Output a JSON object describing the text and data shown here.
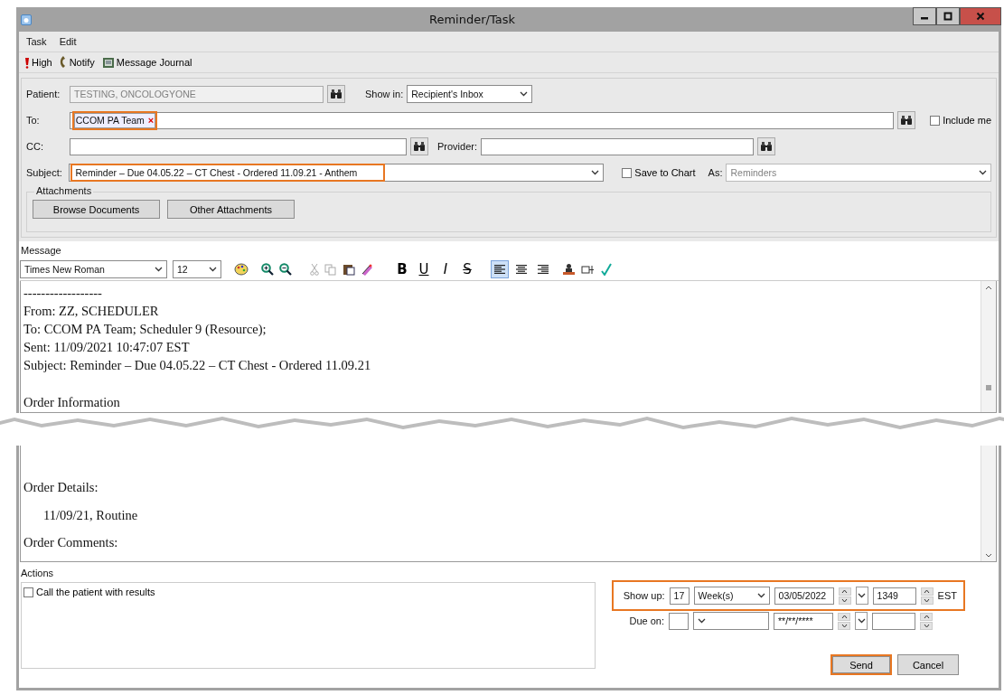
{
  "window": {
    "title": "Reminder/Task"
  },
  "menu": [
    {
      "label": "Task"
    },
    {
      "label": "Edit"
    }
  ],
  "toolbar": [
    {
      "kind": "priority",
      "label": "High"
    },
    {
      "kind": "phone",
      "label": "Notify"
    },
    {
      "kind": "journal",
      "label": "Message Journal"
    }
  ],
  "form": {
    "patient": {
      "label": "Patient:",
      "value": "TESTING, ONCOLOGYONE",
      "disabled": true
    },
    "show_in": {
      "label": "Show in:",
      "value": "Recipient's Inbox"
    },
    "to": {
      "label": "To:",
      "recipients": [
        {
          "name": "CCOM PA Team",
          "remove": "×"
        }
      ],
      "highlighted": true
    },
    "include_me": {
      "label": "Include me",
      "checked": false
    },
    "cc": {
      "label": "CC:"
    },
    "provider": {
      "label": "Provider:"
    },
    "subject": {
      "label": "Subject:",
      "value": "Reminder – Due 04.05.22 – CT Chest - Ordered 11.09.21 - Anthem",
      "highlighted": true
    },
    "save_to_chart": {
      "label": "Save to Chart",
      "checked": false
    },
    "as": {
      "label": "As:",
      "value": "Reminders",
      "disabled": true
    },
    "attachments": {
      "label": "Attachments",
      "buttons": [
        "Browse Documents",
        "Other Attachments"
      ]
    }
  },
  "message": {
    "label": "Message",
    "font": "Times New Roman",
    "size": "12",
    "format_buttons": [
      {
        "kind": "bold",
        "label": "B"
      },
      {
        "kind": "underline",
        "label": "U"
      },
      {
        "kind": "italic",
        "label": "I"
      },
      {
        "kind": "strike",
        "label": "S"
      }
    ],
    "align_buttons": [
      {
        "kind": "left",
        "selected": true
      },
      {
        "kind": "center",
        "selected": false
      },
      {
        "kind": "right",
        "selected": false
      }
    ],
    "header_lines": [
      "------------------",
      "From: ZZ, SCHEDULER",
      "To: CCOM PA Team; Scheduler 9 (Resource);",
      "Sent: 11/09/2021 10:47:07 EST",
      "Subject: Reminder – Due 04.05.22 – CT Chest - Ordered 11.09.21"
    ],
    "top_sections": [
      {
        "text": "Order Information",
        "indent": false
      }
    ],
    "bottom_sections": [
      {
        "text": "Order Details:",
        "indent": false
      },
      {
        "text": "11/09/21, Routine",
        "indent": true
      },
      {
        "text": "Order Comments:",
        "indent": false
      }
    ]
  },
  "actions": {
    "label": "Actions",
    "items": [
      {
        "label": "Call the patient with results",
        "checked": false
      }
    ]
  },
  "show_up": {
    "label": "Show up:",
    "count": "17",
    "unit": "Week(s)",
    "date": "03/05/2022",
    "time": "1349",
    "zone": "EST",
    "highlighted": true
  },
  "due_on": {
    "label": "Due on:",
    "date": "**/**/****"
  },
  "buttons": [
    {
      "label": "Send",
      "highlighted": true
    },
    {
      "label": "Cancel",
      "highlighted": false
    }
  ]
}
